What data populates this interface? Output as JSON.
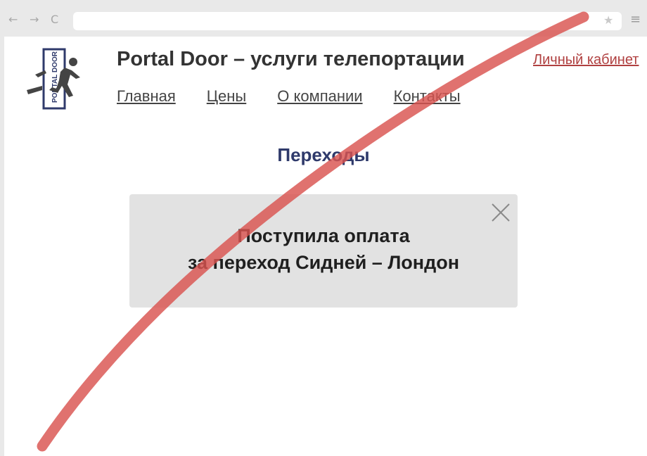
{
  "browser": {
    "back_icon": "←",
    "forward_icon": "→",
    "reload_icon": "C",
    "address": "",
    "star_icon": "★",
    "menu_icon": "≡"
  },
  "logo": {
    "text": "PORTAL DOOR",
    "color": "#2f3a6b"
  },
  "header": {
    "title": "Portal Door – услуги телепортации",
    "account_link": "Личный кабинет",
    "nav": [
      "Главная",
      "Цены",
      "О компании",
      "Контакты"
    ]
  },
  "main": {
    "section_title": "Переходы",
    "notice": {
      "line1": "Поступила оплата",
      "line2": "за переход Сидней – Лондон",
      "close_icon": "close-icon"
    }
  },
  "overlay": {
    "slash_color": "#d9534f"
  }
}
